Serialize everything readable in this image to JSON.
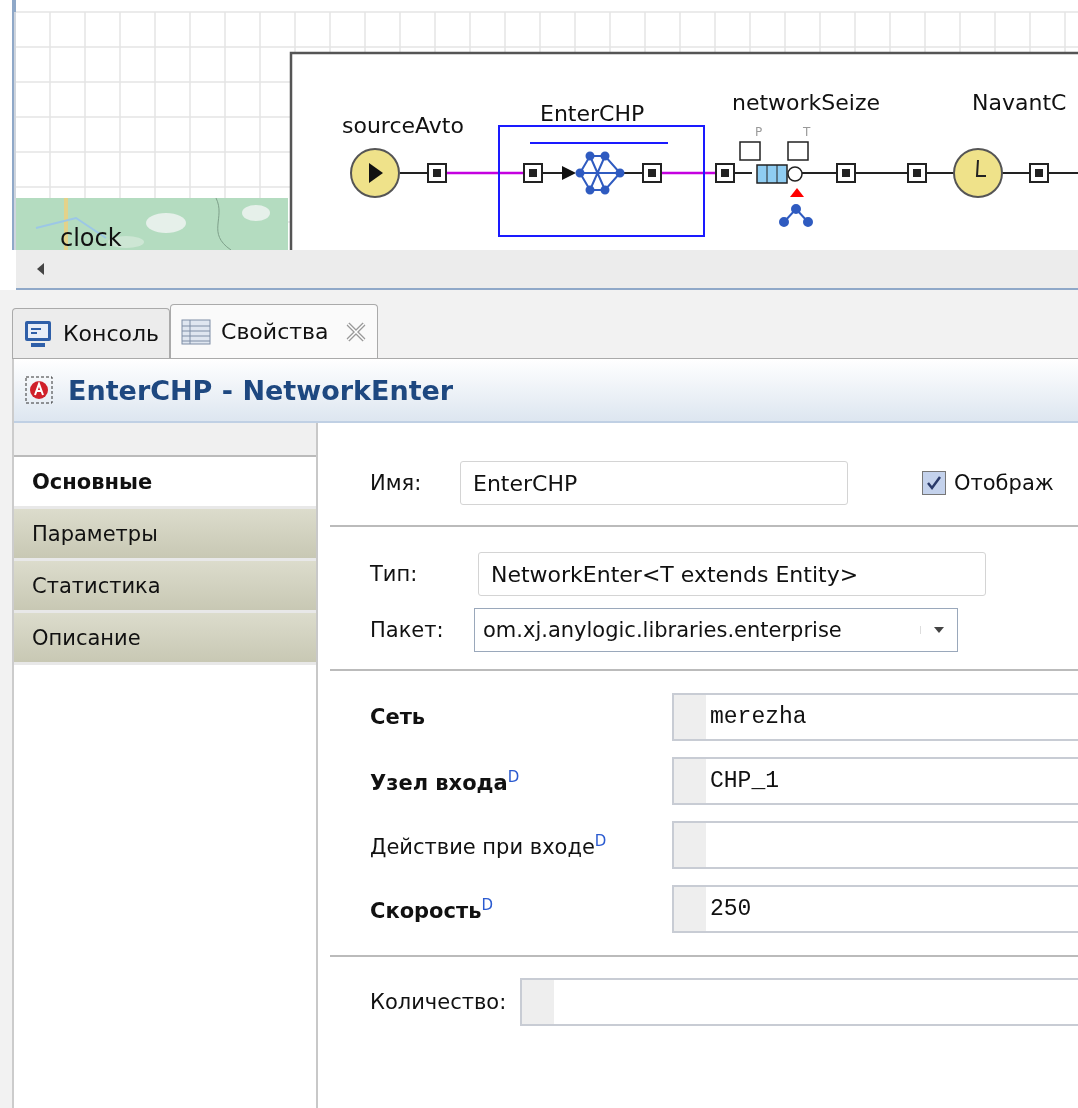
{
  "canvas": {
    "map_label": "clock",
    "blocks": [
      {
        "name": "sourceAvto",
        "kind": "source",
        "selected": false
      },
      {
        "name": "EnterCHP",
        "kind": "network_enter",
        "selected": true
      },
      {
        "name": "networkSeize",
        "kind": "seize",
        "selected": false,
        "port_labels": [
          "P",
          "T"
        ]
      },
      {
        "name": "NavantC",
        "kind": "delay",
        "selected": false
      }
    ]
  },
  "tabs": [
    {
      "label": "Консоль",
      "kind": "console",
      "selected": false,
      "closable": false
    },
    {
      "label": "Свойства",
      "kind": "properties",
      "selected": true,
      "closable": true
    }
  ],
  "title": "EnterCHP - NetworkEnter",
  "sections": [
    {
      "label": "Основные",
      "selected": true
    },
    {
      "label": "Параметры",
      "selected": false
    },
    {
      "label": "Статистика",
      "selected": false
    },
    {
      "label": "Описание",
      "selected": false
    }
  ],
  "name_field": {
    "label": "Имя:",
    "value": "EnterCHP"
  },
  "show_checkbox": {
    "label": "Отображ",
    "checked": true
  },
  "type_field": {
    "label": "Тип:",
    "value": "NetworkEnter<T extends Entity>"
  },
  "package_field": {
    "label": "Пакет:",
    "value": "om.xj.anylogic.libraries.enterprise"
  },
  "parameters": [
    {
      "label": "Сеть",
      "bold": true,
      "value": "merezha"
    },
    {
      "label": "Узел входа$^{D}$",
      "bold": true,
      "value": "CHP_1"
    },
    {
      "label": "Действие при входе$^{D}$",
      "bold": false
    },
    {
      "label": "Скорость$^{D}$",
      "bold": true,
      "value": "250"
    }
  ],
  "quantity": {
    "label": "Количество:"
  }
}
